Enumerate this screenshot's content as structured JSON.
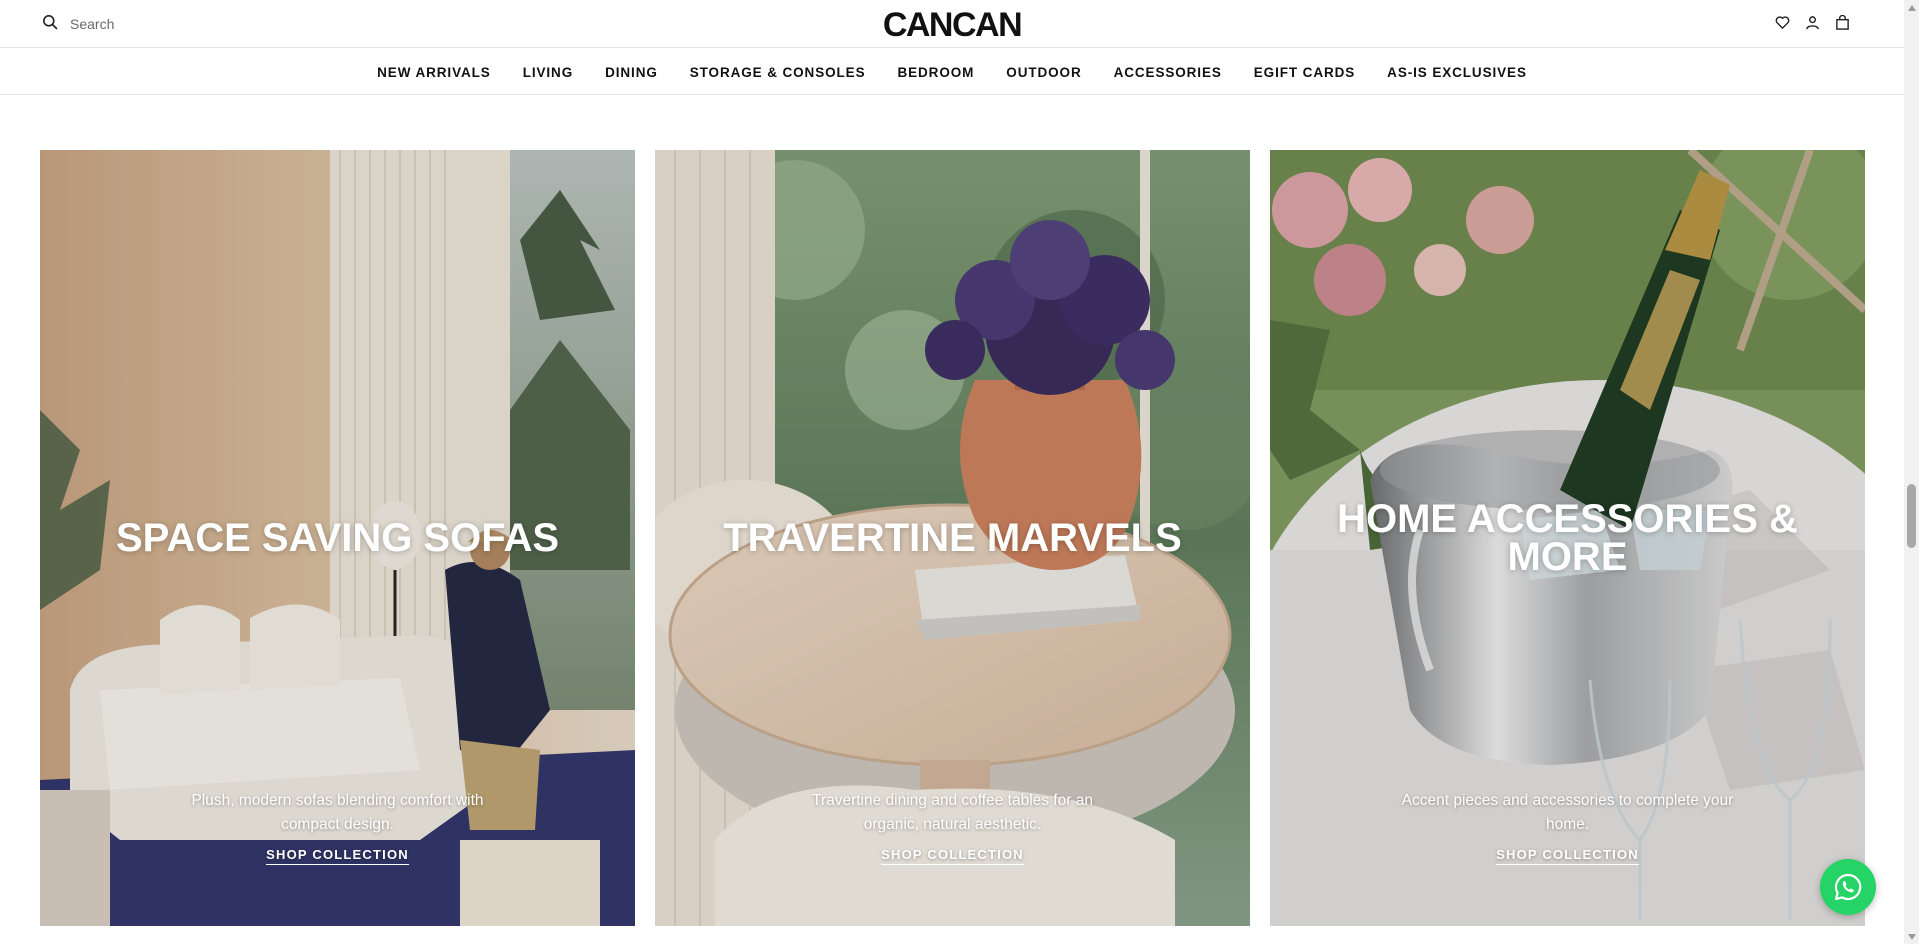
{
  "header": {
    "search": {
      "placeholder": "Search",
      "icon": "search-icon"
    },
    "brand": "CANCAN",
    "icons": [
      "heart-icon",
      "account-icon",
      "cart-icon"
    ]
  },
  "nav": {
    "items": [
      "NEW ARRIVALS",
      "LIVING",
      "DINING",
      "STORAGE & CONSOLES",
      "BEDROOM",
      "OUTDOOR",
      "ACCESSORIES",
      "EGIFT CARDS",
      "AS-IS EXCLUSIVES"
    ]
  },
  "cards": [
    {
      "title": "SPACE SAVING SOFAS",
      "description": "Plush, modern sofas blending comfort with compact design.",
      "cta": "SHOP COLLECTION"
    },
    {
      "title": "TRAVERTINE MARVELS",
      "description": "Travertine dining and coffee tables for an organic, natural aesthetic.",
      "cta": "SHOP COLLECTION"
    },
    {
      "title": "HOME ACCESSORIES & MORE",
      "description": "Accent pieces and accessories to complete your home.",
      "cta": "SHOP COLLECTION"
    }
  ],
  "colors": {
    "whatsapp": "#25D366",
    "text": "#111111",
    "border": "#e5e5e5"
  },
  "widgets": {
    "chat": "whatsapp-icon"
  }
}
